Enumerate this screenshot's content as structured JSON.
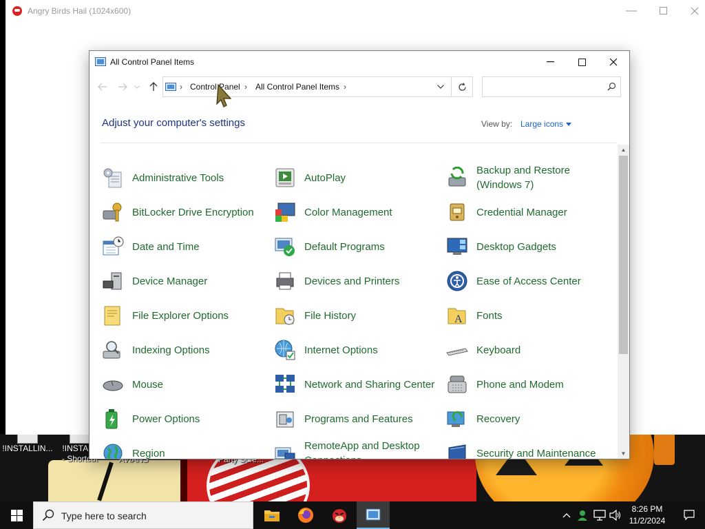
{
  "background_window": {
    "title": "Angry Birds Hail (1024x600)"
  },
  "desktop": {
    "icons": [
      {
        "label": "!INSTALLIN..."
      },
      {
        "label": "!INSTALL"
      },
      {
        "label": "- Shortcut"
      },
      {
        "label": "AVIANS"
      },
      {
        "label": "Party Scre..."
      }
    ]
  },
  "window": {
    "title": "All Control Panel Items",
    "breadcrumb": [
      "Control Panel",
      "All Control Panel Items"
    ],
    "search_placeholder": "",
    "heading": "Adjust your computer's settings",
    "view_by_label": "View by:",
    "view_by_value": "Large icons",
    "items": [
      {
        "label": "Administrative Tools",
        "icon": "administrative-tools-icon"
      },
      {
        "label": "AutoPlay",
        "icon": "autoplay-icon"
      },
      {
        "label": "Backup and Restore (Windows 7)",
        "icon": "backup-restore-icon"
      },
      {
        "label": "BitLocker Drive Encryption",
        "icon": "bitlocker-icon"
      },
      {
        "label": "Color Management",
        "icon": "color-management-icon"
      },
      {
        "label": "Credential Manager",
        "icon": "credential-manager-icon"
      },
      {
        "label": "Date and Time",
        "icon": "date-time-icon"
      },
      {
        "label": "Default Programs",
        "icon": "default-programs-icon"
      },
      {
        "label": "Desktop Gadgets",
        "icon": "desktop-gadgets-icon"
      },
      {
        "label": "Device Manager",
        "icon": "device-manager-icon"
      },
      {
        "label": "Devices and Printers",
        "icon": "devices-printers-icon"
      },
      {
        "label": "Ease of Access Center",
        "icon": "ease-of-access-icon"
      },
      {
        "label": "File Explorer Options",
        "icon": "file-explorer-options-icon"
      },
      {
        "label": "File History",
        "icon": "file-history-icon"
      },
      {
        "label": "Fonts",
        "icon": "fonts-icon"
      },
      {
        "label": "Indexing Options",
        "icon": "indexing-options-icon"
      },
      {
        "label": "Internet Options",
        "icon": "internet-options-icon"
      },
      {
        "label": "Keyboard",
        "icon": "keyboard-icon"
      },
      {
        "label": "Mouse",
        "icon": "mouse-icon"
      },
      {
        "label": "Network and Sharing Center",
        "icon": "network-sharing-icon"
      },
      {
        "label": "Phone and Modem",
        "icon": "phone-modem-icon"
      },
      {
        "label": "Power Options",
        "icon": "power-options-icon"
      },
      {
        "label": "Programs and Features",
        "icon": "programs-features-icon"
      },
      {
        "label": "Recovery",
        "icon": "recovery-icon"
      },
      {
        "label": "Region",
        "icon": "region-icon"
      },
      {
        "label": "RemoteApp and Desktop Connections",
        "icon": "remoteapp-icon"
      },
      {
        "label": "Security and Maintenance",
        "icon": "security-maintenance-icon"
      }
    ]
  },
  "taskbar": {
    "search_placeholder": "Type here to search",
    "apps": [
      {
        "name": "file-explorer-icon"
      },
      {
        "name": "firefox-icon"
      },
      {
        "name": "angry-birds-icon"
      },
      {
        "name": "control-panel-icon"
      }
    ],
    "clock_time": "8:26 PM",
    "clock_date": "11/2/2024"
  },
  "colors": {
    "link_green": "#1f6b2e",
    "heading_blue": "#1e3287",
    "accent_blue": "#1a63c9"
  }
}
